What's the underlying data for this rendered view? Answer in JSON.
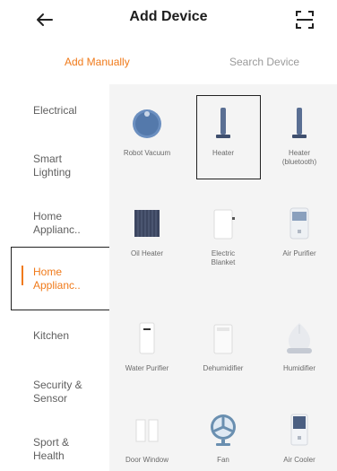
{
  "header": {
    "title": "Add Device"
  },
  "tabs": [
    {
      "label": "Add Manually",
      "active": true
    },
    {
      "label": "Search Device",
      "active": false
    }
  ],
  "sidebar": {
    "items": [
      {
        "label": "Electrical",
        "active": false
      },
      {
        "label": "Smart\nLighting",
        "active": false
      },
      {
        "label": "Home\nApplianc..",
        "active": false
      },
      {
        "label": "Home\nApplianc..",
        "active": true
      },
      {
        "label": "Kitchen",
        "active": false
      },
      {
        "label": "Security &\nSensor",
        "active": false
      },
      {
        "label": "Sport &\nHealth",
        "active": false
      }
    ]
  },
  "devices": [
    {
      "label": "Robot Vacuum",
      "icon": "robot-vacuum-icon"
    },
    {
      "label": "Heater",
      "icon": "heater-icon",
      "selected": true
    },
    {
      "label": "Heater\n(bluetooth)",
      "icon": "heater-icon"
    },
    {
      "label": "Oil Heater",
      "icon": "oil-heater-icon"
    },
    {
      "label": "Electric\nBlanket",
      "icon": "electric-blanket-icon"
    },
    {
      "label": "Air Purifier",
      "icon": "air-purifier-icon"
    },
    {
      "label": "Water Purifier",
      "icon": "water-purifier-icon"
    },
    {
      "label": "Dehumidifier",
      "icon": "dehumidifier-icon"
    },
    {
      "label": "Humidifier",
      "icon": "humidifier-icon"
    },
    {
      "label": "Door Window",
      "icon": "door-window-icon"
    },
    {
      "label": "Fan",
      "icon": "fan-icon"
    },
    {
      "label": "Air Cooler",
      "icon": "air-cooler-icon"
    }
  ],
  "colors": {
    "accent": "#f07a1a",
    "content_bg": "#f4f4f4"
  }
}
